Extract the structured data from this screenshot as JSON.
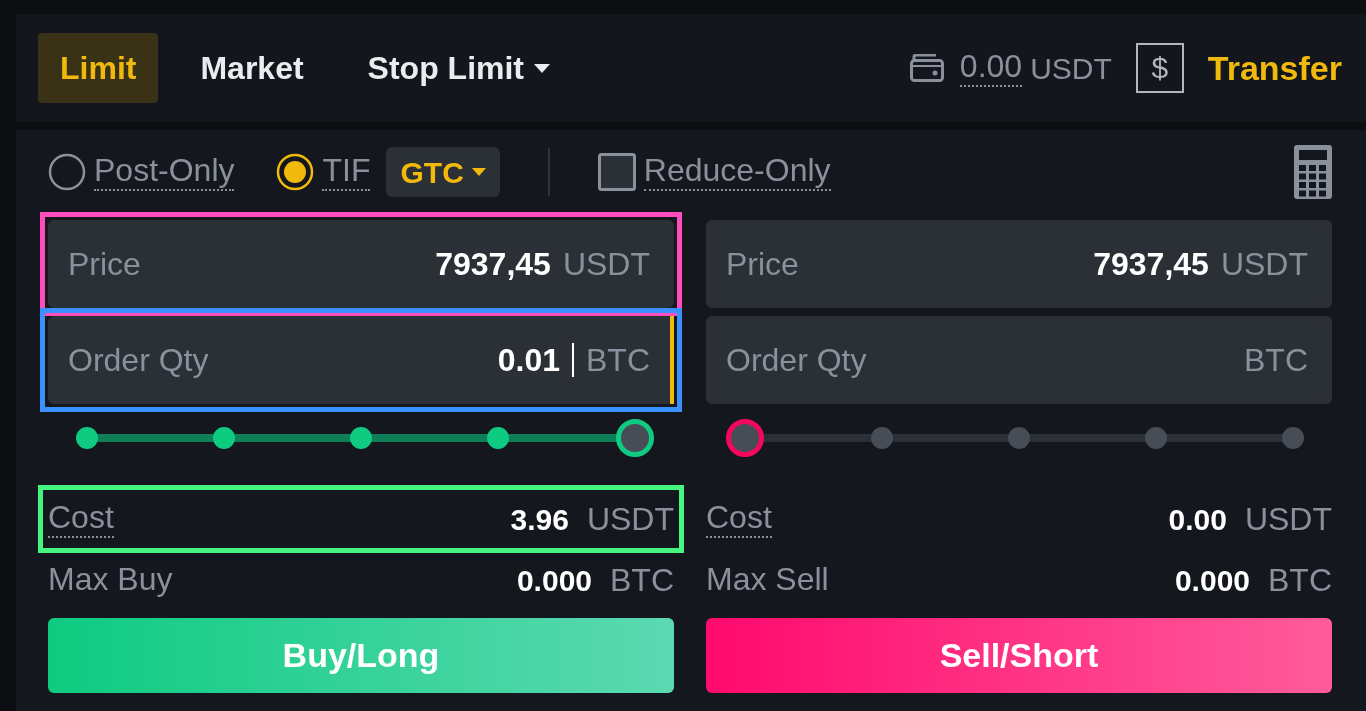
{
  "order_types": [
    {
      "label": "Limit",
      "selected": true,
      "dropdown": false
    },
    {
      "label": "Market",
      "selected": false,
      "dropdown": false
    },
    {
      "label": "Stop Limit",
      "selected": false,
      "dropdown": true
    }
  ],
  "balance": {
    "amount": "0.00",
    "unit": "USDT"
  },
  "currency_button": "$",
  "transfer": "Transfer",
  "options": [
    {
      "kind": "radio",
      "label": "Post-Only",
      "checked": false
    },
    {
      "kind": "radio",
      "label": "TIF",
      "checked": true,
      "select": "GTC"
    },
    {
      "kind": "checkbox",
      "label": "Reduce-Only",
      "checked": false
    }
  ],
  "forms": [
    {
      "kind": "buy",
      "fields": [
        {
          "label": "Price",
          "value": "7937,45",
          "unit": "USDT",
          "focused": false,
          "color": "#ff4dbd"
        },
        {
          "label": "Order Qty",
          "value": "0.01",
          "unit": "BTC",
          "focused": true,
          "color": "#3a90ff"
        }
      ],
      "slider": {
        "level": 1
      },
      "summary": [
        {
          "label": "Cost",
          "value": "3.96",
          "unit": "USDT",
          "tooltip": true,
          "color": "#44f57f"
        },
        {
          "label": "Max Buy",
          "value": "0.000",
          "unit": "BTC",
          "tooltip": false
        }
      ],
      "button": "Buy/Long"
    },
    {
      "kind": "sell",
      "fields": [
        {
          "label": "Price",
          "value": "7937,45",
          "unit": "USDT",
          "focused": false
        },
        {
          "label": "Order Qty",
          "unit": "BTC",
          "focused": false
        }
      ],
      "slider": {
        "level": 0
      },
      "summary": [
        {
          "label": "Cost",
          "value": "0.00",
          "unit": "USDT",
          "tooltip": true
        },
        {
          "label": "Max Sell",
          "value": "0.000",
          "unit": "BTC",
          "tooltip": false
        }
      ],
      "button": "Sell/Short"
    }
  ]
}
